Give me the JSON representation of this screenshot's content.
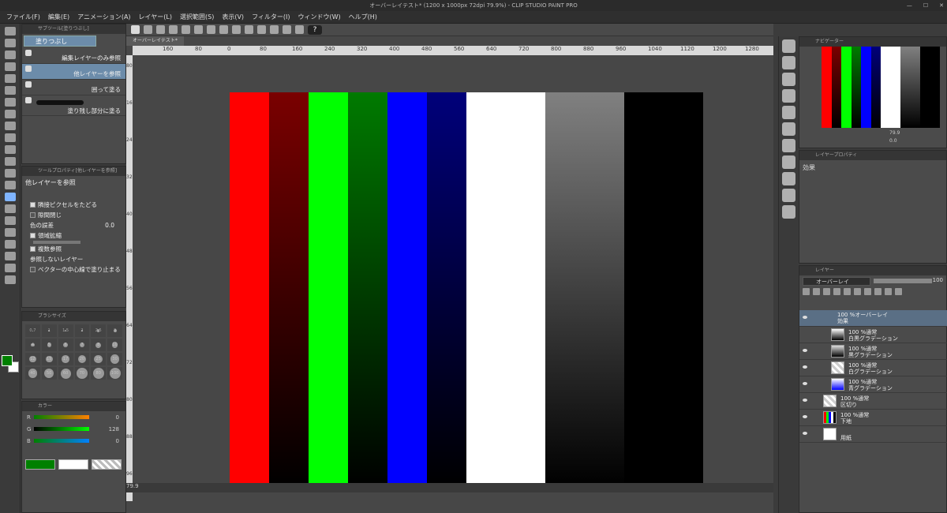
{
  "window": {
    "title": "オーバーレイテスト* (1200 x 1000px 72dpi 79.9%)  - CLIP STUDIO PAINT PRO"
  },
  "menu": [
    "ファイル(F)",
    "編集(E)",
    "アニメーション(A)",
    "レイヤー(L)",
    "選択範囲(S)",
    "表示(V)",
    "フィルター(I)",
    "ウィンドウ(W)",
    "ヘルプ(H)"
  ],
  "command_bar": {
    "help": "?"
  },
  "subtool": {
    "header": "サブツール[塗りつぶし]",
    "group": "塗りつぶし",
    "items": [
      "編集レイヤーのみ参照",
      "他レイヤーを参照",
      "囲って塗る",
      "塗り残し部分に塗る"
    ],
    "selected": "他レイヤーを参照"
  },
  "tool_property": {
    "header": "ツールプロパティ[他レイヤーを参照]",
    "title": "他レイヤーを参照",
    "rows": [
      {
        "label": "隣接ピクセルをたどる",
        "checked": true
      },
      {
        "label": "隙間閉じ",
        "checked": false
      },
      {
        "label": "色の誤差",
        "value": "0.0"
      },
      {
        "label": "領域拡縮",
        "checked": true
      },
      {
        "label": "複数参照",
        "checked": true
      },
      {
        "label": "参照しないレイヤー",
        "checked": null
      },
      {
        "label": "ベクターの中心線で塗り止まる",
        "checked": false
      }
    ]
  },
  "brush_size": {
    "header": "ブラシサイズ",
    "sizes": [
      "0.7",
      "1",
      "1.5",
      "2",
      "2.5",
      "3",
      "4",
      "5",
      "6",
      "7",
      "8",
      "10",
      "12",
      "15",
      "17",
      "20",
      "25",
      "30",
      "40",
      "50",
      "60",
      "70",
      "80",
      "100"
    ]
  },
  "color_panel": {
    "header": "カラー",
    "rows": [
      {
        "label": "R",
        "value": "0"
      },
      {
        "label": "G",
        "value": "128"
      },
      {
        "label": "B",
        "value": "0"
      }
    ],
    "main_color": "#008000",
    "sub_color": "#ffffff"
  },
  "document": {
    "tab": "オーバーレイテスト*",
    "ruler_h": [
      "160",
      "80",
      "0",
      "80",
      "160",
      "240",
      "320",
      "400",
      "480",
      "560",
      "640",
      "720",
      "800",
      "880",
      "960",
      "1040",
      "1120",
      "1200",
      "1280",
      "13"
    ],
    "ruler_v": [
      "80",
      "160",
      "240",
      "320",
      "400",
      "480",
      "560",
      "640",
      "720",
      "800",
      "880",
      "960"
    ],
    "status_zoom": "79.9"
  },
  "image_stripes": [
    {
      "colors": [
        "#ff0000",
        "#ff0000"
      ]
    },
    {
      "colors": [
        "#7a0000",
        "#000000"
      ]
    },
    {
      "colors": [
        "#00ff00",
        "#00ff00"
      ]
    },
    {
      "colors": [
        "#007a00",
        "#000000"
      ]
    },
    {
      "colors": [
        "#0000ff",
        "#0000ff"
      ]
    },
    {
      "colors": [
        "#00007a",
        "#000000"
      ]
    },
    {
      "colors": [
        "#ffffff",
        "#ffffff"
      ]
    },
    {
      "colors": [
        "#ffffff",
        "#ffffff"
      ]
    },
    {
      "colors": [
        "#808080",
        "#000000"
      ]
    },
    {
      "colors": [
        "#808080",
        "#000000"
      ]
    },
    {
      "colors": [
        "#000000",
        "#000000"
      ]
    },
    {
      "colors": [
        "#000000",
        "#000000"
      ]
    }
  ],
  "navigator": {
    "header": "ナビゲーター",
    "zoom": "79.9",
    "rotate": "0.0"
  },
  "layer_property": {
    "header": "レイヤープロパティ",
    "label": "効果"
  },
  "layers_panel": {
    "header": "レイヤー",
    "blend_mode": "オーバーレイ",
    "opacity": "100",
    "list": [
      {
        "kind": "folder",
        "line1": "100 %オーバーレイ",
        "line2": "効果"
      },
      {
        "kind": "sub",
        "line1": "100 %通常",
        "line2": "白黒グラデーション"
      },
      {
        "kind": "sub",
        "line1": "100 %通常",
        "line2": "黒グラデーション"
      },
      {
        "kind": "sub",
        "line1": "100 %通常",
        "line2": "白グラデーション"
      },
      {
        "kind": "sub",
        "line1": "100 %通常",
        "line2": "青グラデーション"
      },
      {
        "kind": "top",
        "line1": "100 %通常",
        "line2": "区切り"
      },
      {
        "kind": "top",
        "line1": "100 %通常",
        "line2": "下地"
      },
      {
        "kind": "top",
        "line1": "",
        "line2": "用紙"
      }
    ]
  }
}
